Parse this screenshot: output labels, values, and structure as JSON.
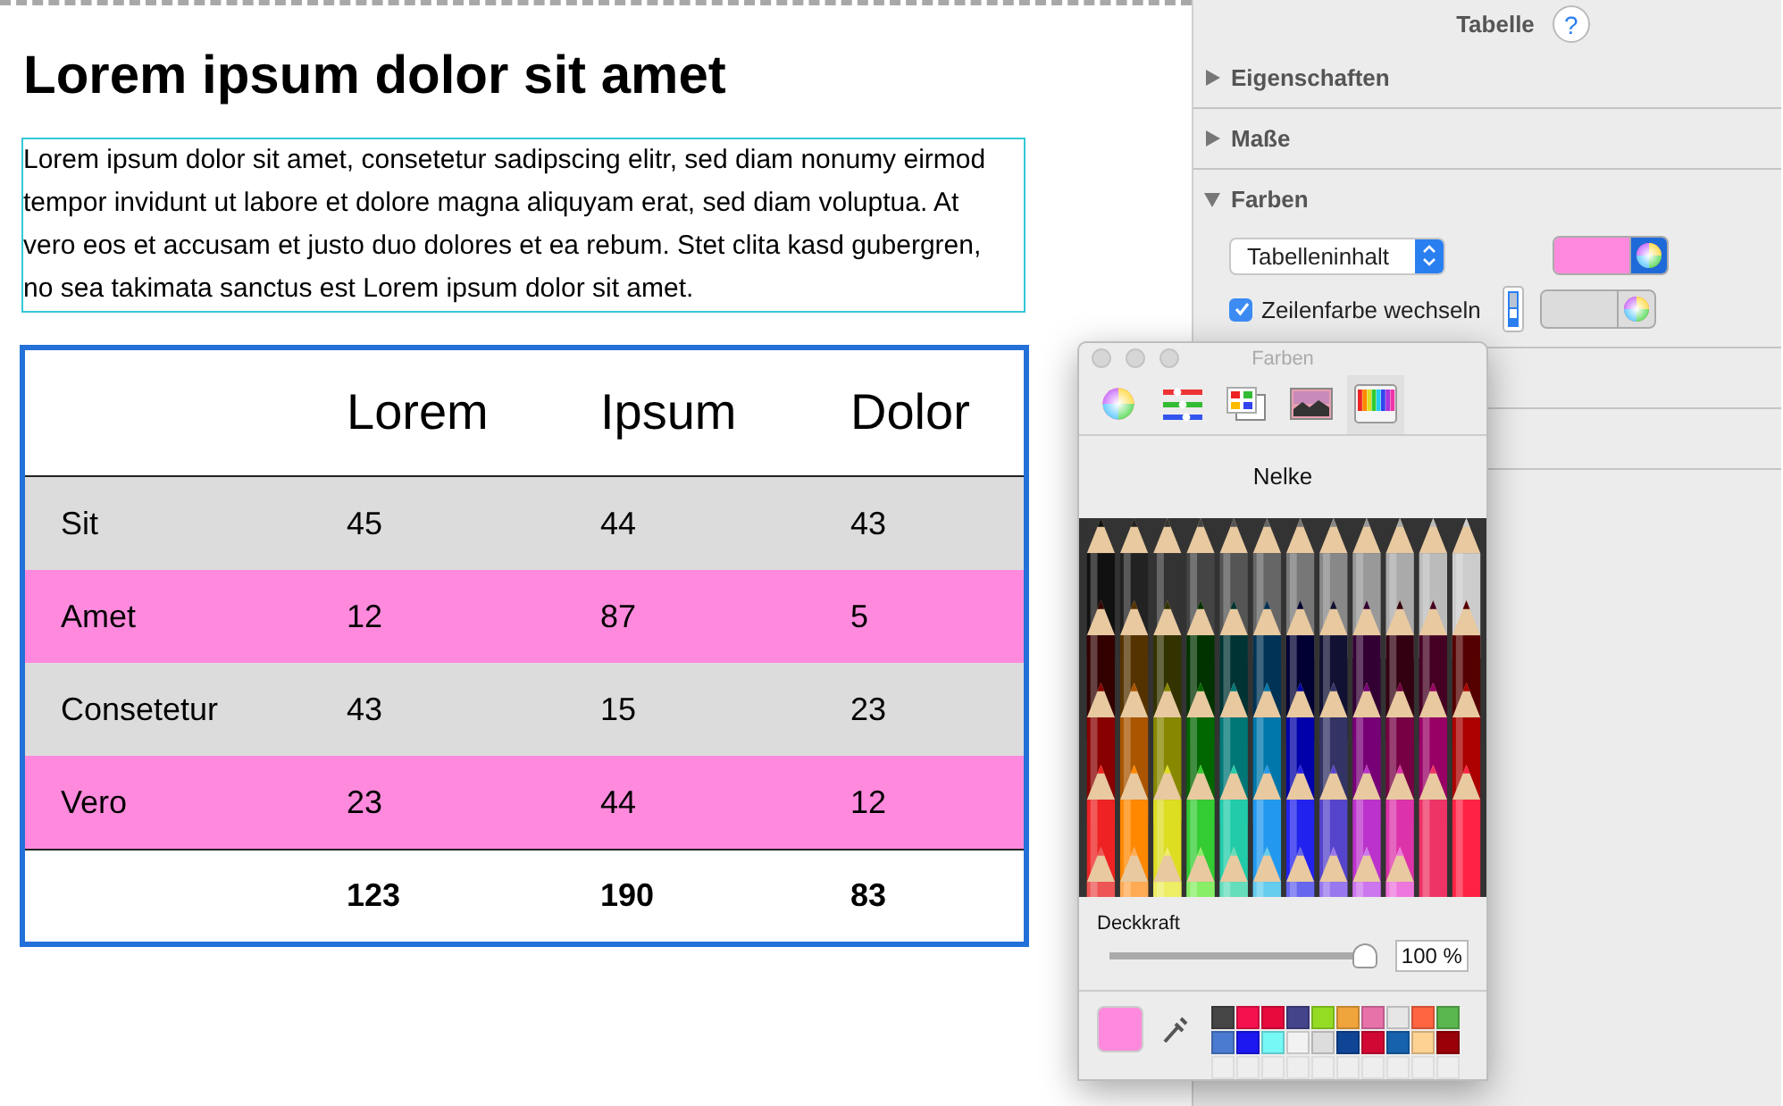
{
  "document": {
    "heading": "Lorem ipsum dolor sit amet",
    "paragraph": "Lorem ipsum dolor sit amet, consetetur sadipscing elitr, sed diam nonumy eirmod tempor invidunt ut labore et dolore magna aliquyam erat, sed diam voluptua. At vero eos et accusam et justo duo dolores et ea rebum. Stet clita kasd gubergren, no sea takimata sanctus est Lorem ipsum dolor sit amet.",
    "table": {
      "selected": true,
      "columns": [
        "Lorem",
        "Ipsum",
        "Dolor"
      ],
      "rows": [
        {
          "label": "Sit",
          "color": "#dcdcdc",
          "values": [
            "45",
            "44",
            "43"
          ]
        },
        {
          "label": "Amet",
          "color": "#ff8add",
          "values": [
            "12",
            "87",
            "5"
          ]
        },
        {
          "label": "Consetetur",
          "color": "#dcdcdc",
          "values": [
            "43",
            "15",
            "23"
          ]
        },
        {
          "label": "Vero",
          "color": "#ff8add",
          "values": [
            "23",
            "44",
            "12"
          ]
        }
      ],
      "totals": [
        "123",
        "190",
        "83"
      ]
    }
  },
  "sidebar": {
    "title": "Tabelle",
    "help": "?",
    "sections": [
      {
        "label": "Eigenschaften",
        "expanded": false
      },
      {
        "label": "Maße",
        "expanded": false
      },
      {
        "label": "Farben",
        "expanded": true
      }
    ],
    "fill_popup": "Tabelleninhalt",
    "fill_well": {
      "color": "#ff8add"
    },
    "alternate": {
      "label": "Zeilenfarbe wechseln",
      "checked": true,
      "color": "#dcdcdc"
    }
  },
  "colors_window": {
    "title": "Farben",
    "tool_tabs": [
      {
        "selected": false
      },
      {
        "selected": false
      },
      {
        "selected": false
      },
      {
        "selected": false
      },
      {
        "selected": true
      }
    ],
    "color_name": "Nelke",
    "opacity_label": "Deckkraft",
    "level": 1,
    "opacity_value": "100 %",
    "current": {
      "color": "#ff8add"
    },
    "swatches": [
      {
        "color": "#454545"
      },
      {
        "color": "#f5104e"
      },
      {
        "color": "#e80a3d"
      },
      {
        "color": "#434489"
      },
      {
        "color": "#94dc24"
      },
      {
        "color": "#f0a43c"
      },
      {
        "color": "#e772a9"
      },
      {
        "color": "#e6e6e6"
      },
      {
        "color": "#ff6540"
      },
      {
        "color": "#5ab64e"
      },
      {
        "color": "#4b7bd0"
      },
      {
        "color": "#1d17f0"
      },
      {
        "color": "#75f8f6"
      },
      {
        "color": "#f2f2f2"
      },
      {
        "color": "#dddddd"
      },
      {
        "color": "#104495"
      },
      {
        "color": "#d20834"
      },
      {
        "color": "#1762ad"
      },
      {
        "color": "#fdd293"
      },
      {
        "color": "#990008"
      }
    ]
  }
}
